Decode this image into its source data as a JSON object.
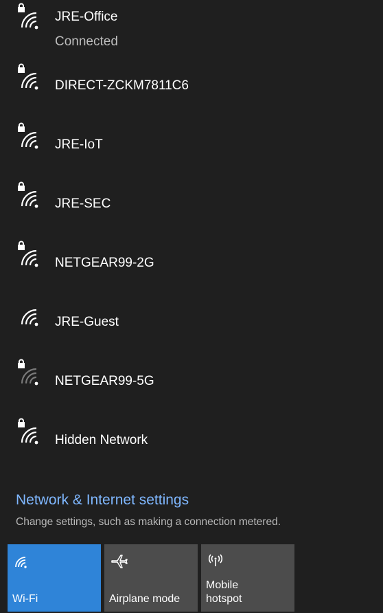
{
  "networks": [
    {
      "name": "JRE-Office",
      "status": "Connected",
      "icon": "secured-wifi-signal-icon"
    },
    {
      "name": "DIRECT-ZCKM7811C6",
      "icon": "secured-wifi-signal-icon"
    },
    {
      "name": "JRE-IoT",
      "icon": "secured-wifi-signal-icon"
    },
    {
      "name": "JRE-SEC",
      "icon": "secured-wifi-signal-icon"
    },
    {
      "name": "NETGEAR99-2G",
      "icon": "secured-wifi-signal-icon"
    },
    {
      "name": "JRE-Guest",
      "icon": "open-wifi-signal-icon"
    },
    {
      "name": "NETGEAR99-5G",
      "icon": "secured-weak-wifi-signal-icon"
    },
    {
      "name": "Hidden Network",
      "icon": "secured-wifi-signal-icon"
    }
  ],
  "settings": {
    "title": "Network & Internet settings",
    "description": "Change settings, such as making a connection metered."
  },
  "quick_actions": [
    {
      "label": "Wi-Fi",
      "icon": "wifi-icon",
      "active": true
    },
    {
      "label": "Airplane mode",
      "icon": "airplane-icon",
      "active": false
    },
    {
      "label": "Mobile hotspot",
      "icon": "mobile-hotspot-icon",
      "active": false
    }
  ],
  "colors": {
    "background": "#1f1f1f",
    "accent": "#2f84d8",
    "link": "#7fb7ff",
    "tile": "#4c4c4c",
    "secondary_text": "#bdbdbd",
    "weak_signal_bars": "#7a7a7a"
  }
}
